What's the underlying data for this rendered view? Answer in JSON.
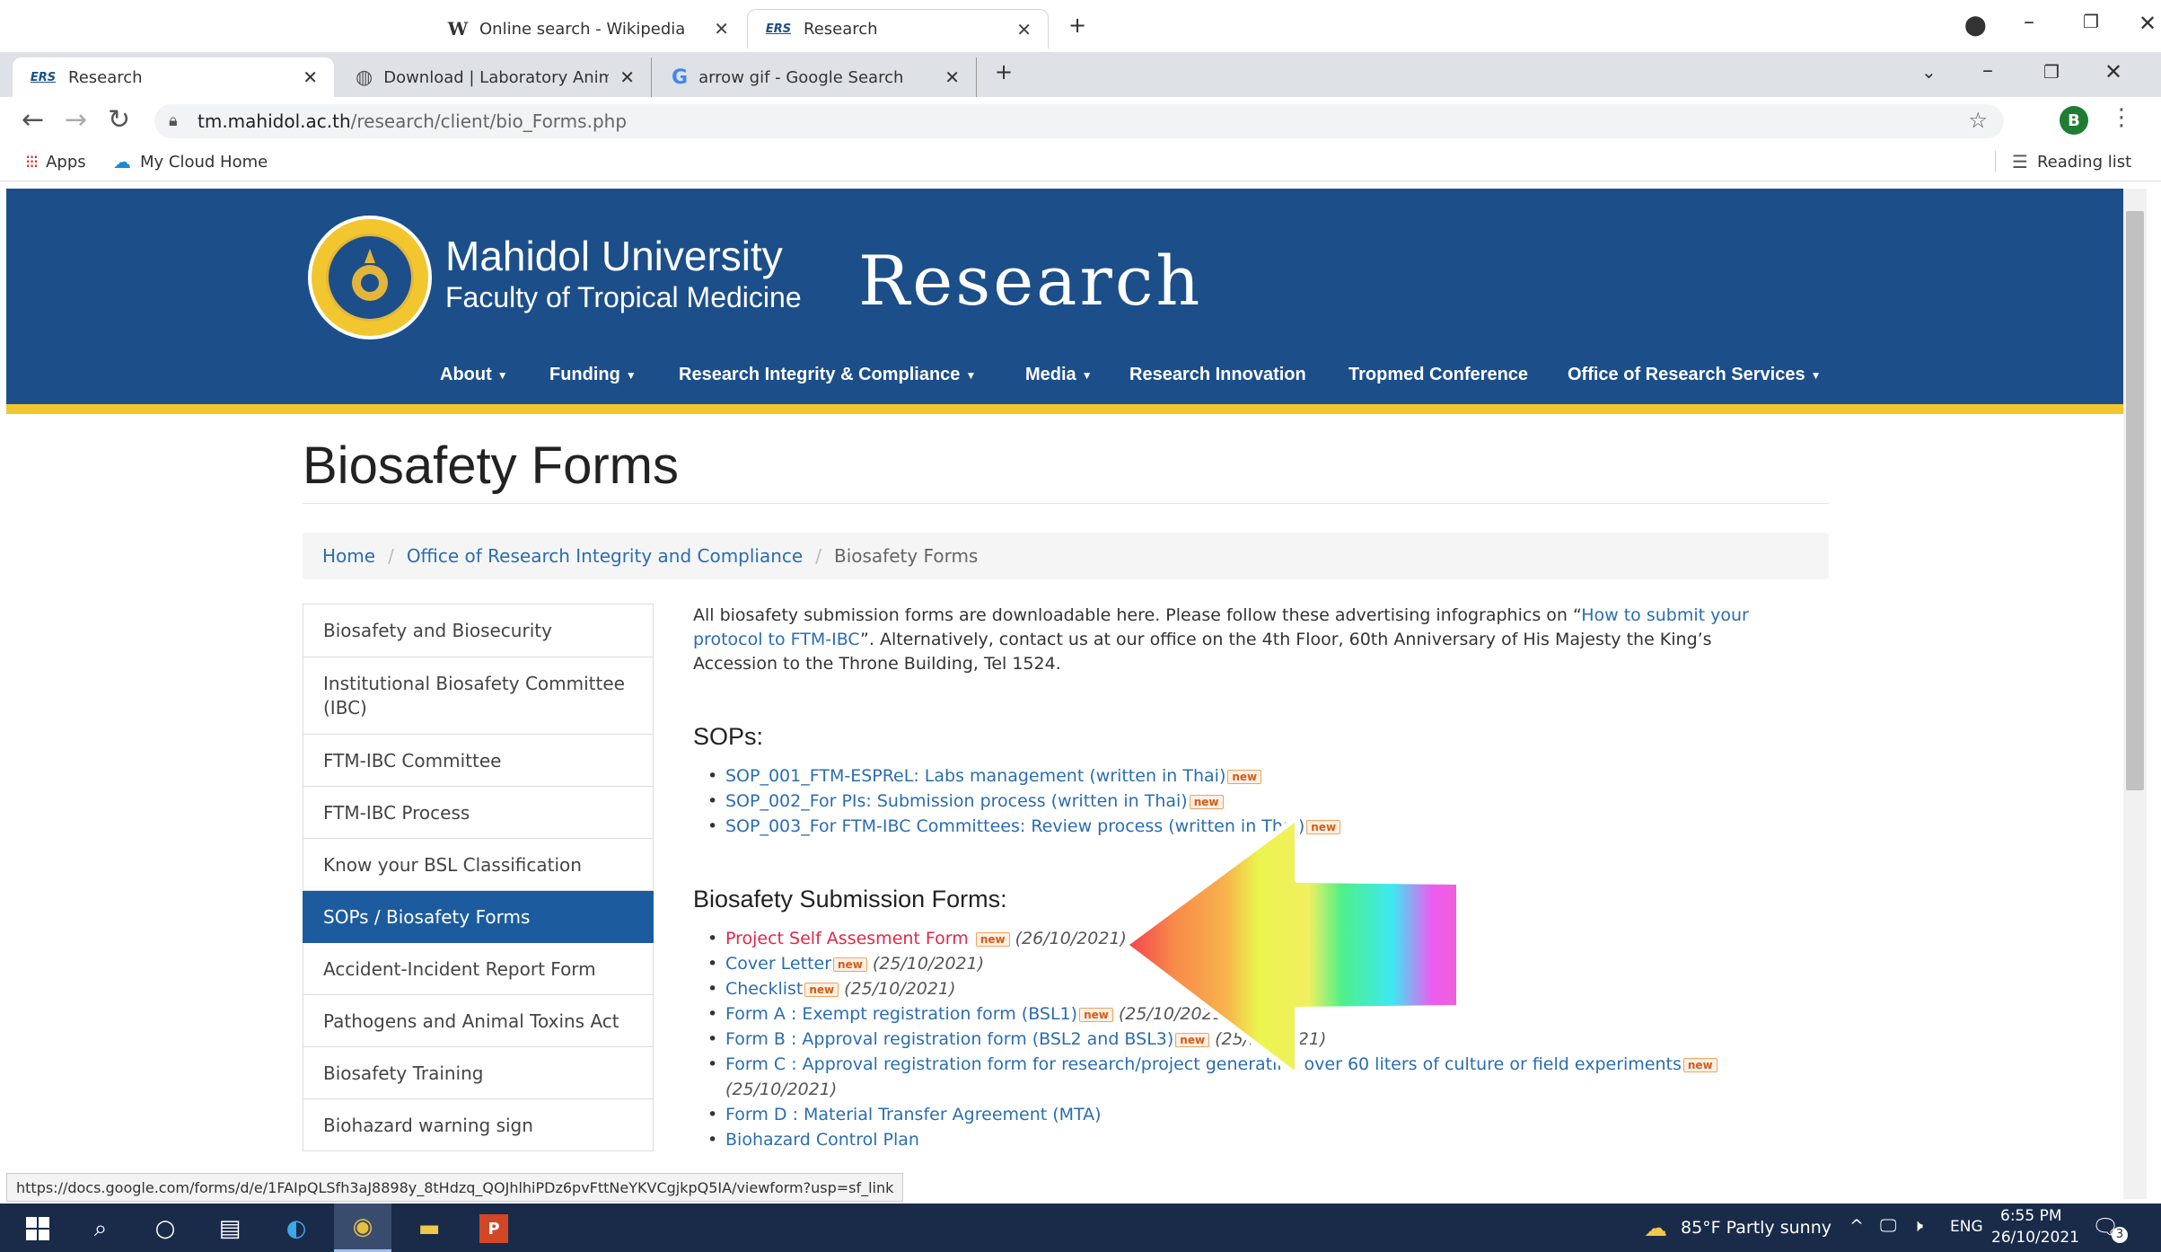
{
  "background_window": {
    "tabs": [
      {
        "label": "Online search - Wikipedia",
        "icon": "wikipedia-icon"
      },
      {
        "label": "Research",
        "icon": "ers-icon"
      }
    ],
    "new_tab": "+"
  },
  "browser": {
    "tabs": [
      {
        "label": "Research",
        "icon": "ers-icon"
      },
      {
        "label": "Download | Laboratory Animal Sc",
        "icon": "globe-icon"
      },
      {
        "label": "arrow gif - Google Search",
        "icon": "google-icon"
      }
    ],
    "new_tab": "+",
    "url_domain": "tm.mahidol.ac.th",
    "url_path": "/research/client/bio_Forms.php",
    "profile_letter": "B",
    "bookmarks": [
      {
        "label": "Apps"
      },
      {
        "label": "My Cloud Home"
      }
    ],
    "reading_list": "Reading list"
  },
  "site": {
    "university": "Mahidol University",
    "faculty": "Faculty of Tropical Medicine",
    "title": "Research",
    "nav": [
      {
        "label": "About",
        "dropdown": true
      },
      {
        "label": "Funding",
        "dropdown": true
      },
      {
        "label": "Research Integrity & Compliance",
        "dropdown": true
      },
      {
        "label": "Media",
        "dropdown": true
      },
      {
        "label": "Research Innovation",
        "dropdown": false
      },
      {
        "label": "Tropmed Conference",
        "dropdown": false
      },
      {
        "label": "Office of Research Services",
        "dropdown": true
      }
    ]
  },
  "page": {
    "title": "Biosafety Forms",
    "breadcrumb": [
      "Home",
      "Office of Research Integrity and Compliance",
      "Biosafety Forms"
    ],
    "sidebar": [
      {
        "label": "Biosafety and Biosecurity",
        "active": false
      },
      {
        "label": "Institutional Biosafety Committee (IBC)",
        "active": false
      },
      {
        "label": "FTM-IBC Committee",
        "active": false
      },
      {
        "label": "FTM-IBC Process",
        "active": false
      },
      {
        "label": "Know your BSL Classification",
        "active": false
      },
      {
        "label": "SOPs / Biosafety Forms",
        "active": true
      },
      {
        "label": "Accident-Incident Report Form",
        "active": false
      },
      {
        "label": "Pathogens and Animal Toxins Act",
        "active": false
      },
      {
        "label": "Biosafety Training",
        "active": false
      },
      {
        "label": "Biohazard warning sign",
        "active": false
      }
    ],
    "intro_before": "All biosafety submission forms are downloadable here. Please follow these advertising infographics on “",
    "intro_link": "How to submit your protocol to FTM-IBC",
    "intro_after": "”. Alternatively, contact us at our office on the 4th Floor, 60th Anniversary of His Majesty the King’s Accession to the Throne Building, Tel 1524.",
    "sops_heading": "SOPs:",
    "sops": [
      "SOP_001_FTM-ESPReL: Labs management (written in Thai)",
      "SOP_002_For PIs: Submission process (written in Thai)",
      "SOP_003_For FTM-IBC Committees: Review process (written in Thai)"
    ],
    "new_badge": "new",
    "forms_heading": "Biosafety Submission Forms:",
    "forms": [
      {
        "label": "Project Self Assesment Form",
        "new": true,
        "date": "(26/10/2021)"
      },
      {
        "label": "Cover Letter",
        "new": true,
        "date": "(25/10/2021)"
      },
      {
        "label": "Checklist",
        "new": true,
        "date": "(25/10/2021)"
      },
      {
        "label": "Form A : Exempt registration form (BSL1)",
        "new": true,
        "date": "(25/10/2021)"
      },
      {
        "label": "Form B : Approval registration form (BSL2 and BSL3)",
        "new": true,
        "date": "(25/10/2021)"
      },
      {
        "label": "Form C : Approval registration form for research/project generating over 60 liters of culture or field experiments",
        "new": true,
        "date": "(25/10/2021)"
      },
      {
        "label": "Form D : Material Transfer Agreement (MTA)",
        "new": false,
        "date": ""
      },
      {
        "label": "Biohazard Control Plan",
        "new": false,
        "date": ""
      }
    ]
  },
  "status_url": "https://docs.google.com/forms/d/e/1FAIpQLSfh3aJ8898y_8tHdzq_QOJhlhiPDz6pvFttNeYKVCgjkpQ5IA/viewform?usp=sf_link",
  "taskbar": {
    "weather": "85°F  Partly sunny",
    "lang": "ENG",
    "time": "6:55 PM",
    "date": "26/10/2021",
    "notifications": "3"
  },
  "colors": {
    "header_blue": "#1c4f8a",
    "accent_gold": "#f2c62f",
    "link_blue": "#2a6db0",
    "active_sidebar": "#1c5c9e",
    "new_badge": "#d45b16"
  }
}
